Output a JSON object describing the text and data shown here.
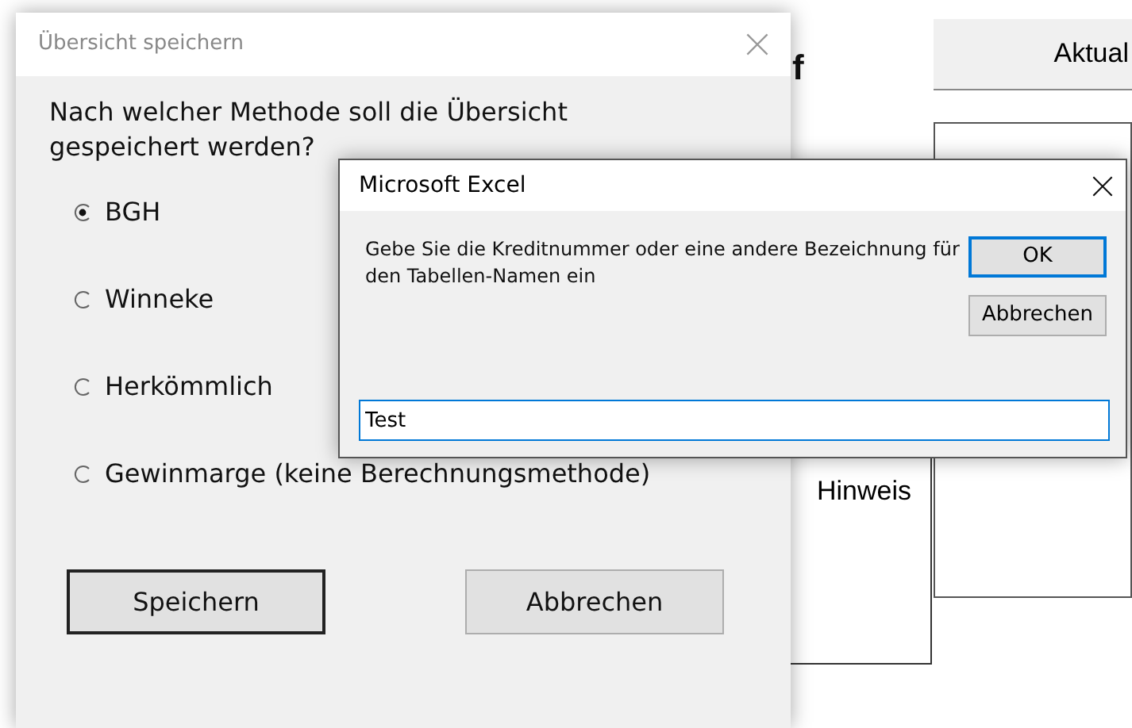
{
  "background": {
    "cell_text": "f",
    "buttons": [
      "Aktual",
      "Hinweis"
    ]
  },
  "save_dialog": {
    "title": "Übersicht speichern",
    "question": "Nach welcher Methode soll die Übersicht gespeichert werden?",
    "options": [
      {
        "label": "BGH",
        "selected": true
      },
      {
        "label": "Winneke",
        "selected": false
      },
      {
        "label": "Herkömmlich",
        "selected": false
      },
      {
        "label": "Gewinmarge (keine Berechnungsmethode)",
        "selected": false
      }
    ],
    "buttons": [
      {
        "label": "Speichern",
        "default": true
      },
      {
        "label": "Abbrechen",
        "default": false
      }
    ]
  },
  "excel_dialog": {
    "title": "Microsoft Excel",
    "prompt": "Gebe Sie die Kreditnummer oder eine andere Bezeichnung für den Tabellen-Namen ein",
    "input_value": "Test",
    "buttons": [
      {
        "label": "OK",
        "default": true
      },
      {
        "label": "Abbrechen",
        "default": false
      }
    ]
  }
}
